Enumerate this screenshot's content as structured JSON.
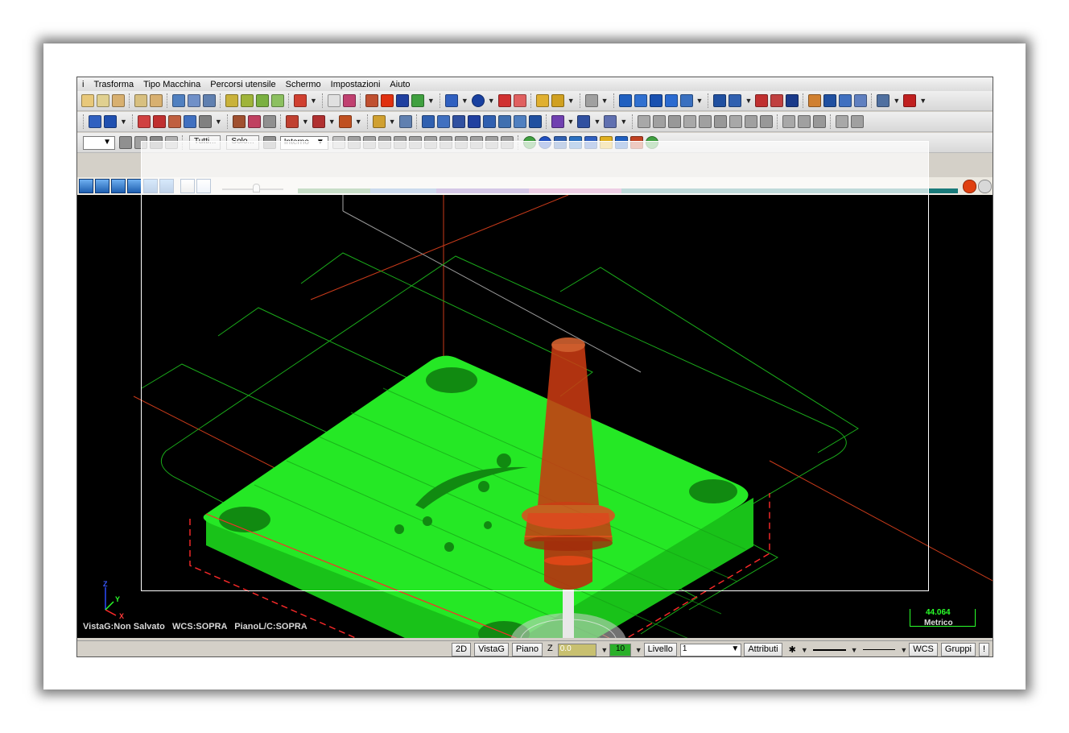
{
  "menu": {
    "items": [
      "i",
      "Trasforma",
      "Tipo Macchina",
      "Percorsi utensile",
      "Schermo",
      "Impostazioni",
      "Aiuto"
    ]
  },
  "toolbar3": {
    "tutti_label": "Tutti...",
    "solo_label": "Solo...",
    "interno_value": "Interno"
  },
  "viewport": {
    "view_info": "VistaG:Non Salvato   WCS:SOPRA   PianoL/C:SOPRA",
    "scale_value": "44.064",
    "scale_unit": "Metrico",
    "axis_y": "Y",
    "axis_x": "X",
    "axis_z": "Z"
  },
  "statusbar": {
    "btn_2d": "2D",
    "btn_vistag": "VistaG",
    "btn_piano": "Piano",
    "z_label": "Z",
    "z_value": "0.0",
    "depth_value": "10",
    "livello_label": "Livello",
    "livello_value": "1",
    "attributi_label": "Attributi",
    "wcs_label": "WCS",
    "gruppi_label": "Gruppi",
    "help_label": "!"
  },
  "colors": {
    "part": "#22ee22",
    "tool": "#cc3a12",
    "background": "#000000"
  }
}
